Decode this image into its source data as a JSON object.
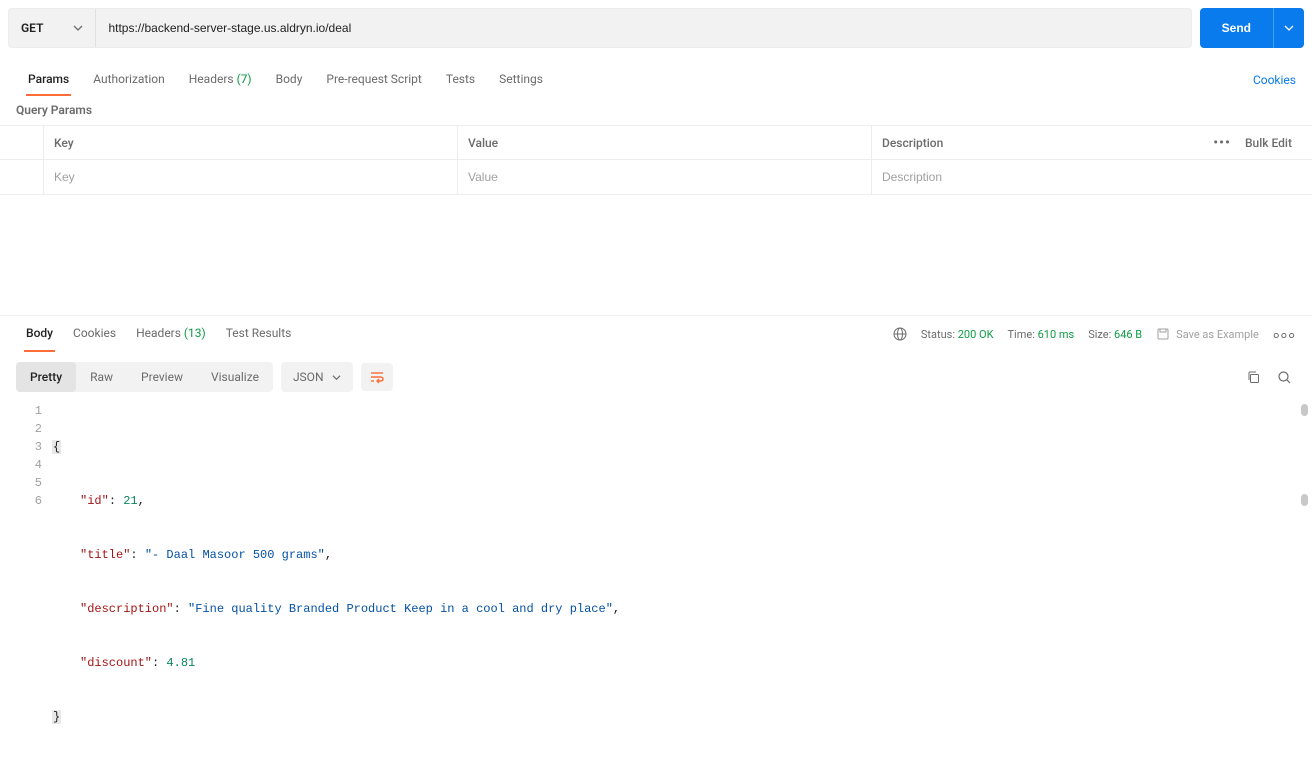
{
  "request": {
    "method": "GET",
    "url": "https://backend-server-stage.us.aldryn.io/deal",
    "send_label": "Send"
  },
  "req_tabs": {
    "params": "Params",
    "authorization": "Authorization",
    "headers_label": "Headers",
    "headers_count": "(7)",
    "body": "Body",
    "prerequest": "Pre-request Script",
    "tests": "Tests",
    "settings": "Settings",
    "cookies_link": "Cookies"
  },
  "query_params": {
    "section_label": "Query Params",
    "col_key": "Key",
    "col_value": "Value",
    "col_desc": "Description",
    "bulk_edit": "Bulk Edit",
    "ph_key": "Key",
    "ph_value": "Value",
    "ph_desc": "Description"
  },
  "res_tabs": {
    "body": "Body",
    "cookies": "Cookies",
    "headers_label": "Headers",
    "headers_count": "(13)",
    "test_results": "Test Results"
  },
  "res_meta": {
    "status_label": "Status:",
    "status_value": "200 OK",
    "time_label": "Time:",
    "time_value": "610 ms",
    "size_label": "Size:",
    "size_value": "646 B",
    "save_example": "Save as Example"
  },
  "view": {
    "pretty": "Pretty",
    "raw": "Raw",
    "preview": "Preview",
    "visualize": "Visualize",
    "format": "JSON"
  },
  "response_body": {
    "k_id": "\"id\"",
    "v_id": "21",
    "k_title": "\"title\"",
    "v_title": "\"- Daal Masoor 500 grams\"",
    "k_description": "\"description\"",
    "v_description": "\"Fine quality Branded Product Keep in a cool and dry place\"",
    "k_discount": "\"discount\"",
    "v_discount": "4.81"
  },
  "line_numbers": [
    "1",
    "2",
    "3",
    "4",
    "5",
    "6"
  ]
}
